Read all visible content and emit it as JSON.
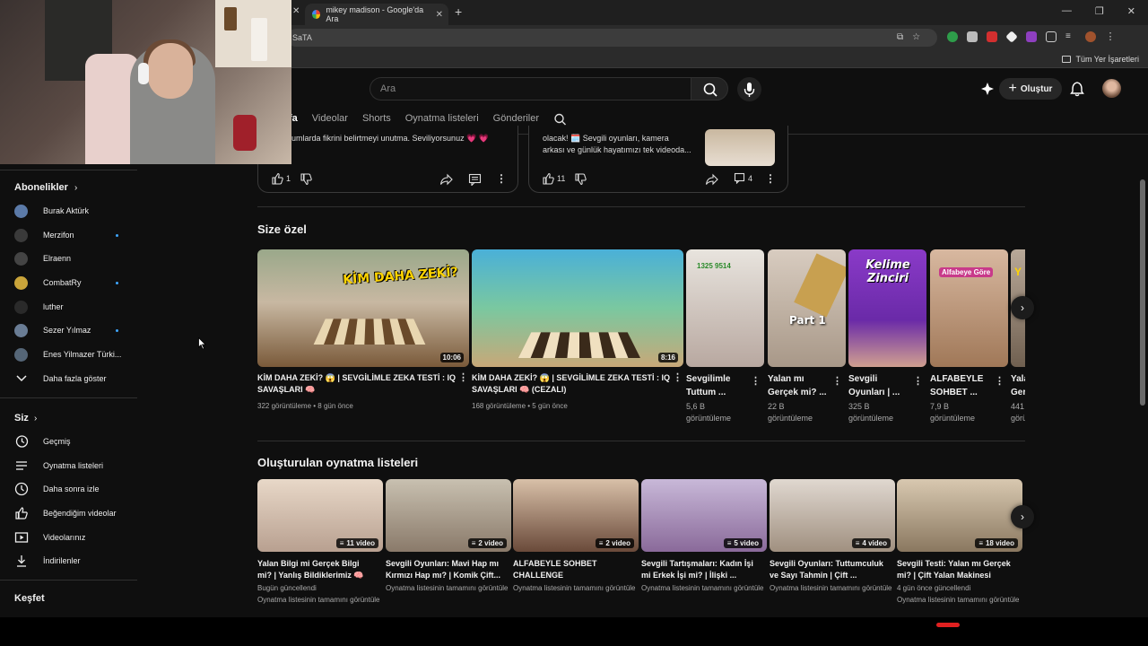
{
  "browser": {
    "tab_title": "mikey madison - Google'da Ara",
    "address_text": "SaTA",
    "bookmarks_label": "Tüm Yer İşaretleri"
  },
  "header": {
    "search_placeholder": "Ara",
    "create_label": "Oluştur",
    "create_plus": "+"
  },
  "channel_tabs": [
    {
      "label": "fa"
    },
    {
      "label": "Videolar"
    },
    {
      "label": "Shorts"
    },
    {
      "label": "Oynatma listeleri"
    },
    {
      "label": "Gönderiler"
    }
  ],
  "posts": [
    {
      "text": "umlarda fikrini belirtmeyi unutma. Seviliyorsunuz 💗 💗",
      "likes": "1",
      "comments": ""
    },
    {
      "text1": "olacak! 🗓️ Sevgili oyunları, kamera",
      "text2": "arkası ve günlük hayatımızı tek videoda...",
      "likes": "11",
      "comments": "4"
    }
  ],
  "sidebar": {
    "subs_header": "Abonelikler",
    "subs": [
      {
        "name": "Burak Aktürk",
        "color": "#5b7aa8",
        "dot": false
      },
      {
        "name": "Merzifon",
        "color": "#3a3a3a",
        "dot": true
      },
      {
        "name": "Elraenn",
        "color": "#444444",
        "dot": false
      },
      {
        "name": "CombatRy",
        "color": "#c9a43a",
        "dot": true
      },
      {
        "name": "luther",
        "color": "#2a2a2a",
        "dot": false
      },
      {
        "name": "Sezer Yılmaz",
        "color": "#6a7d95",
        "dot": true
      },
      {
        "name": "Enes Yilmazer Türki...",
        "color": "#556677",
        "dot": false
      }
    ],
    "show_more": "Daha fazla göster",
    "you_header": "Siz",
    "you_items": [
      {
        "label": "Geçmiş",
        "icon": "history-icon"
      },
      {
        "label": "Oynatma listeleri",
        "icon": "playlists-icon"
      },
      {
        "label": "Daha sonra izle",
        "icon": "watch-later-icon"
      },
      {
        "label": "Beğendiğim videolar",
        "icon": "like-icon"
      },
      {
        "label": "Videolarınız",
        "icon": "your-videos-icon"
      },
      {
        "label": "İndirilenler",
        "icon": "download-icon"
      }
    ],
    "explore_header": "Keşfet"
  },
  "for_you": {
    "title": "Size özel",
    "videos": [
      {
        "title1": "KİM DAHA ZEKİ? 😱 | SEVGİLİMLE ZEKA TESTİ : IQ",
        "title2": "SAVAŞLARI 🧠",
        "meta": "322 görüntüleme • 8 gün önce",
        "duration": "10:06",
        "overlay": "KİM DAHA ZEKİ?"
      },
      {
        "title1": "KİM DAHA ZEKİ? 😱 | SEVGİLİMLE ZEKA TESTİ : IQ",
        "title2": "SAVAŞLARI 🧠 (CEZALI)",
        "meta": "168 görüntüleme • 5 gün önce",
        "duration": "8:16",
        "overlay": ""
      }
    ],
    "shorts": [
      {
        "title1": "Sevgilimle",
        "title2": "Tuttum ...",
        "meta1": "5,6 B",
        "meta2": "görüntüleme",
        "overlay": "1325   9514"
      },
      {
        "title1": "Yalan mı",
        "title2": "Gerçek mi? ...",
        "meta1": "22 B",
        "meta2": "görüntüleme",
        "overlay": "Part 1"
      },
      {
        "title1": "Sevgili",
        "title2": "Oyunları | ...",
        "meta1": "325 B",
        "meta2": "görüntüleme",
        "overlay": "Kelime Zinciri"
      },
      {
        "title1": "ALFABEYLE",
        "title2": "SOHBET ...",
        "meta1": "7,9 B",
        "meta2": "görüntüleme",
        "overlay": "Alfabeye Göre"
      },
      {
        "title1": "Yala",
        "title2": "Ger",
        "meta1": "441",
        "meta2": "görü",
        "overlay": "Y"
      }
    ]
  },
  "playlists": {
    "title": "Oluşturulan oynatma listeleri",
    "items": [
      {
        "title1": "Yalan Bilgi mi Gerçek Bilgi",
        "title2": "mi? | Yanlış Bildiklerimiz 🧠",
        "meta1": "Bugün güncellendi",
        "meta2": "Oynatma listesinin tamamını görüntüle",
        "count": "11 video"
      },
      {
        "title1": "Sevgili Oyunları: Mavi Hap mı",
        "title2": "Kırmızı Hap mı? | Komik Çift...",
        "meta1": "Oynatma listesinin tamamını görüntüle",
        "meta2": "",
        "count": "2 video"
      },
      {
        "title1": "ALFABEYLE SOHBET",
        "title2": "CHALLENGE",
        "meta1": "Oynatma listesinin tamamını görüntüle",
        "meta2": "",
        "count": "2 video"
      },
      {
        "title1": "Sevgili Tartışmaları: Kadın İşi",
        "title2": "mi Erkek İşi mi? | İlişki ...",
        "meta1": "Oynatma listesinin tamamını görüntüle",
        "meta2": "",
        "count": "5 video"
      },
      {
        "title1": "Sevgili Oyunları: Tuttumculuk",
        "title2": "ve Sayı Tahmin | Çift ...",
        "meta1": "Oynatma listesinin tamamını görüntüle",
        "meta2": "",
        "count": "4 video"
      },
      {
        "title1": "Sevgili Testi: Yalan mı Gerçek",
        "title2": "mi? | Çift Yalan Makinesi",
        "meta1": "4 gün önce güncellendi",
        "meta2": "Oynatma listesinin tamamını görüntüle",
        "count": "18 video"
      }
    ]
  },
  "colors": {
    "accent_blue": "#3ea6ff",
    "bg": "#0f0f0f"
  }
}
